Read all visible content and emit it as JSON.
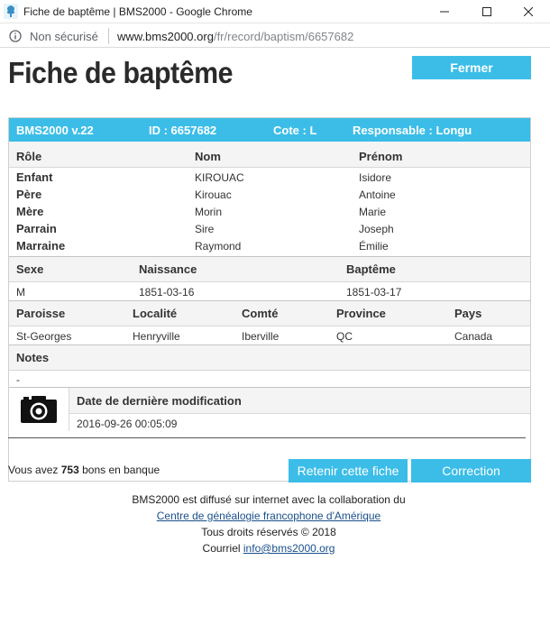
{
  "window": {
    "title": "Fiche de baptême | BMS2000 - Google Chrome",
    "address_security": "Non sécurisé",
    "url_host": "www.bms2000.org",
    "url_path": "/fr/record/baptism/6657682"
  },
  "page": {
    "title": "Fiche de baptême",
    "close_button": "Fermer"
  },
  "record": {
    "header": {
      "version": "BMS2000 v.22",
      "id": "ID : 6657682",
      "cote": "Cote : L",
      "responsable": "Responsable : Longu"
    },
    "people_headers": {
      "role": "Rôle",
      "nom": "Nom",
      "prenom": "Prénom"
    },
    "people": [
      {
        "role": "Enfant",
        "nom": "KIROUAC",
        "prenom": "Isidore"
      },
      {
        "role": "Père",
        "nom": "Kirouac",
        "prenom": "Antoine"
      },
      {
        "role": "Mère",
        "nom": "Morin",
        "prenom": "Marie"
      },
      {
        "role": "Parrain",
        "nom": "Sire",
        "prenom": "Joseph"
      },
      {
        "role": "Marraine",
        "nom": "Raymond",
        "prenom": "Émilie"
      }
    ],
    "birth_headers": {
      "sexe": "Sexe",
      "naissance": "Naissance",
      "bapteme": "Baptême"
    },
    "birth": {
      "sexe": "M",
      "naissance": "1851-03-16",
      "bapteme": "1851-03-17"
    },
    "place_headers": {
      "paroisse": "Paroisse",
      "localite": "Localité",
      "comte": "Comté",
      "province": "Province",
      "pays": "Pays"
    },
    "place": {
      "paroisse": "St-Georges",
      "localite": "Henryville",
      "comte": "Iberville",
      "province": "QC",
      "pays": "Canada"
    },
    "notes_header": "Notes",
    "notes": "-",
    "modified_header": "Date de dernière modification",
    "modified": "2016-09-26 00:05:09"
  },
  "bank": {
    "prefix": "Vous avez",
    "count": "753",
    "suffix": "bons en banque"
  },
  "actions": {
    "keep": "Retenir cette fiche",
    "correct": "Correction"
  },
  "footer": {
    "line1": "BMS2000 est diffusé sur internet avec la collaboration du",
    "link": "Centre de généalogie francophone d'Amérique",
    "rights": "Tous droits réservés © 2018",
    "mail_label": "Courriel",
    "mail": "info@bms2000.org"
  },
  "colors": {
    "accent": "#3bbde8",
    "link": "#1a4f8b"
  }
}
